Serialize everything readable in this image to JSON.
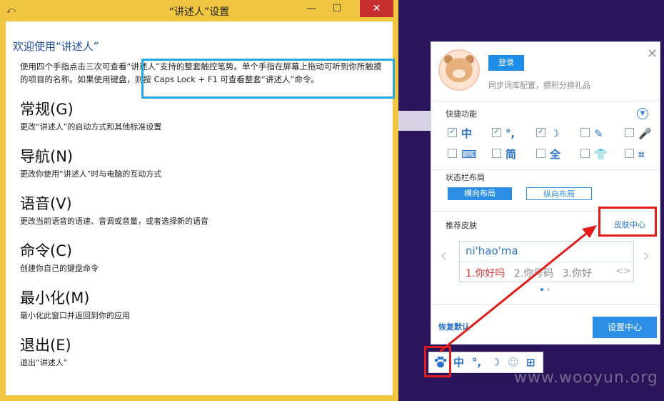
{
  "narrator": {
    "title": "“讲述人”设置",
    "controls": {
      "minimize": "—",
      "maximize": "☐",
      "close": "✕"
    },
    "welcome": "欢迎使用“讲述人”",
    "intro": "使用四个手指点击三次可查看“讲述人”支持的整套触控笔势。单个手指在屏幕上拖动可听到你所触摸的项目的名称。如果使用键盘，则按 Caps Lock + F1 可查看整套“讲述人”命令。",
    "items": [
      {
        "title": "常规(G)",
        "desc": "更改“讲述人”的启动方式和其他标准设置"
      },
      {
        "title": "导航(N)",
        "desc": "更改你使用“讲述人”时与电脑的互动方式"
      },
      {
        "title": "语音(V)",
        "desc": "更改当前语音的语速、音调或音量，或者选择新的语音"
      },
      {
        "title": "命令(C)",
        "desc": "创建你自己的键盘命令"
      },
      {
        "title": "最小化(M)",
        "desc": "最小化此窗口并返回到你的应用"
      },
      {
        "title": "退出(E)",
        "desc": "退出“讲述人”"
      }
    ]
  },
  "ime": {
    "login": "登录",
    "sync_text": "同步词库配置，攒积分换礼品",
    "close": "✕",
    "quick_label": "快捷功能",
    "quick_items": [
      {
        "glyph": "中",
        "checked": true
      },
      {
        "glyph": "°,",
        "checked": true
      },
      {
        "glyph": "☽",
        "checked": true
      },
      {
        "glyph": "✎",
        "checked": false
      },
      {
        "glyph": "🎤",
        "checked": false
      },
      {
        "glyph": "⌨",
        "checked": false
      },
      {
        "glyph": "简",
        "checked": false
      },
      {
        "glyph": "全",
        "checked": false
      },
      {
        "glyph": "👕",
        "checked": false
      },
      {
        "glyph": "⌗",
        "checked": false
      }
    ],
    "status_layout_label": "状态栏布局",
    "layout_horizontal": "横向布局",
    "layout_vertical": "纵向布局",
    "skin_label": "推荐皮肤",
    "skin_center": "皮肤中心",
    "preview_pinyin": "ni'hao'ma",
    "preview_cands": [
      "1.你好吗",
      "2.你号码",
      "3.你好"
    ],
    "preview_more": "<>",
    "restore": "恢复默认",
    "settings_center": "设置中心"
  },
  "statusbar": {
    "items": [
      "中",
      "°,",
      "☽",
      "☺",
      "⊞"
    ]
  },
  "watermark": "www.wooyun.org",
  "colors": {
    "accent": "#2d8ee6",
    "highlight_red": "#e21b1b",
    "highlight_blue": "#27a6e6",
    "window_frame": "#f0c540"
  }
}
